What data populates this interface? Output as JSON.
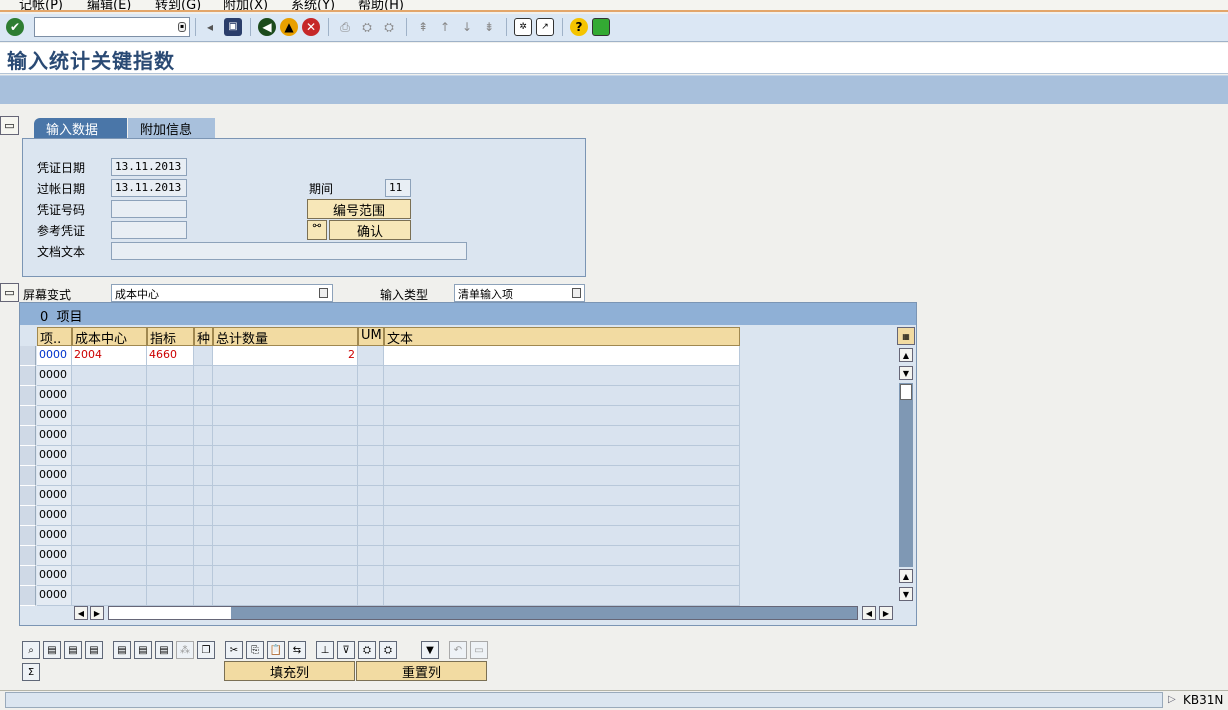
{
  "menu": [
    "记帐(P)",
    "编辑(E)",
    "转到(G)",
    "附加(X)",
    "系统(Y)",
    "帮助(H)"
  ],
  "toolbar": {
    "command_value": "",
    "icons": [
      "enter-icon",
      "save-icon",
      "back-icon",
      "exit-icon",
      "cancel-icon",
      "print-icon",
      "find-icon",
      "find-next-icon",
      "first-page-icon",
      "prev-page-icon",
      "next-page-icon",
      "last-page-icon",
      "new-session-icon",
      "shortcut-icon",
      "help-icon",
      "layout-icon"
    ]
  },
  "page_title": "输入统计关键指数",
  "tabs": [
    "输入数据",
    "附加信息"
  ],
  "header": {
    "doc_date_label": "凭证日期",
    "doc_date": "13.11.2013",
    "posting_date_label": "过帐日期",
    "posting_date": "13.11.2013",
    "doc_no_label": "凭证号码",
    "doc_no": "",
    "ref_doc_label": "参考凭证",
    "ref_doc": "",
    "doc_text_label": "文档文本",
    "doc_text": "",
    "period_label": "期间",
    "period": "11",
    "number_range_button": "编号范围",
    "confirm_button": "确认"
  },
  "screen_variant": {
    "label": "屏幕变式",
    "value": "成本中心",
    "input_type_label": "输入类型",
    "input_type_value": "清单输入项"
  },
  "table": {
    "title_count": "0",
    "title": "项目",
    "columns": [
      "项..",
      "成本中心",
      "指标",
      "种",
      "总计数量",
      "UM",
      "文本"
    ],
    "rows": [
      {
        "item": "0000",
        "cost_center": "2004",
        "indicator": "4660",
        "kind": "",
        "quantity": "2",
        "um": "",
        "text": ""
      },
      {
        "item": "0000"
      },
      {
        "item": "0000"
      },
      {
        "item": "0000"
      },
      {
        "item": "0000"
      },
      {
        "item": "0000"
      },
      {
        "item": "0000"
      },
      {
        "item": "0000"
      },
      {
        "item": "0000"
      },
      {
        "item": "0000"
      },
      {
        "item": "0000"
      },
      {
        "item": "0000"
      },
      {
        "item": "0000"
      }
    ]
  },
  "bottom_toolbar": {
    "fill_column_button": "填充列",
    "reset_column_button": "重置列"
  },
  "status": {
    "transaction": "KB31N"
  }
}
